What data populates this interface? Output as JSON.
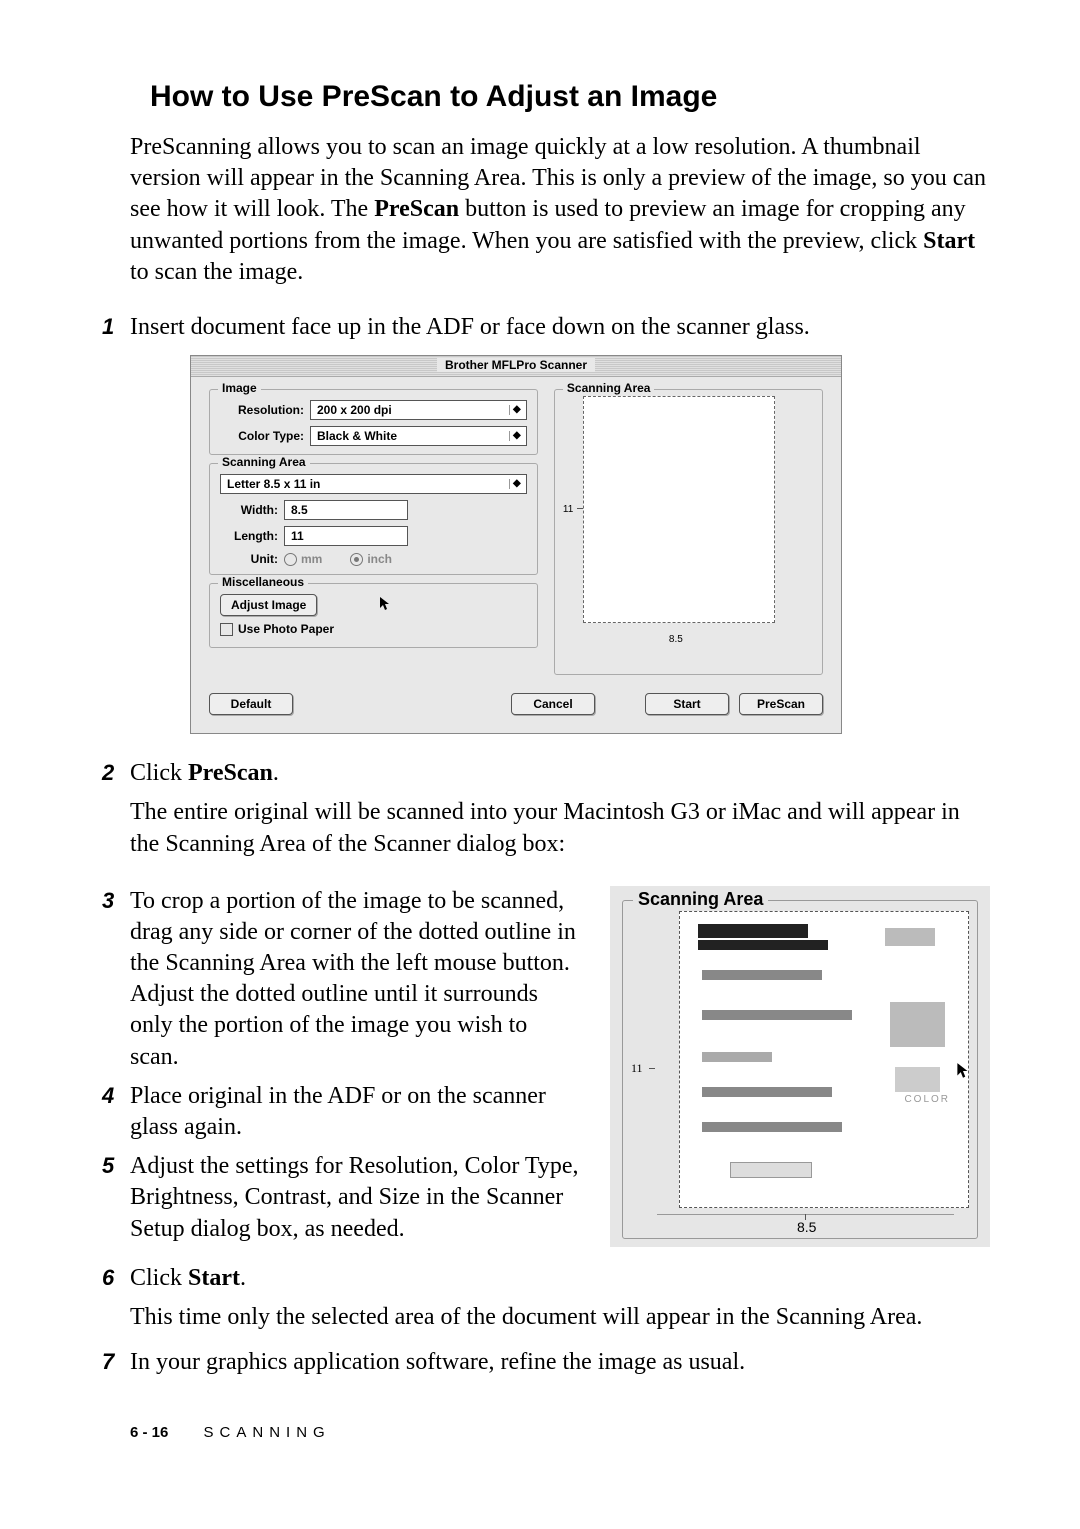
{
  "heading": "How to Use PreScan to Adjust an Image",
  "intro": {
    "t1": "PreScanning allows you to scan an image quickly at a low resolution. A thumbnail version will appear in the Scanning Area. This is only a preview of the image, so you can see how it will look. The ",
    "b1": "PreScan",
    "t2": " button is used to preview an image for cropping any unwanted portions from the image. When you are satisfied with the preview, click ",
    "b2": "Start",
    "t3": " to scan the image."
  },
  "steps": {
    "s1": {
      "num": "1",
      "text": "Insert document face up in the ADF or face down on the scanner glass."
    },
    "s2": {
      "num": "2",
      "t1": "Click ",
      "b1": "PreScan",
      "t2": ".",
      "after": "The entire original will be scanned into your Macintosh G3 or iMac and will appear in the Scanning Area of the Scanner dialog box:"
    },
    "s3": {
      "num": "3",
      "text": "To crop a portion of the image to be scanned, drag any side or corner of the dotted outline in the Scanning Area with the left mouse button. Adjust the dotted outline until it surrounds only the portion of the image you wish to scan."
    },
    "s4": {
      "num": "4",
      "text": "Place original in the ADF or on the scanner glass again."
    },
    "s5": {
      "num": "5",
      "text": "Adjust the settings for Resolution, Color Type, Brightness, Contrast, and Size in the Scanner Setup dialog box, as needed."
    },
    "s6": {
      "num": "6",
      "t1": "Click ",
      "b1": "Start",
      "t2": ".",
      "after": "This time only the selected area of the document will appear in the Scanning Area."
    },
    "s7": {
      "num": "7",
      "text": "In your graphics application software, refine the image as usual."
    }
  },
  "dialog": {
    "title": "Brother MFLPro Scanner",
    "groups": {
      "image": {
        "title": "Image",
        "resolution_label": "Resolution:",
        "resolution_value": "200 x 200 dpi",
        "colortype_label": "Color Type:",
        "colortype_value": "Black & White"
      },
      "scanarea": {
        "title": "Scanning Area",
        "preset_value": "Letter 8.5 x 11 in",
        "width_label": "Width:",
        "width_value": "8.5",
        "length_label": "Length:",
        "length_value": "11",
        "unit_label": "Unit:",
        "unit_mm": "mm",
        "unit_inch": "inch"
      },
      "misc": {
        "title": "Miscellaneous",
        "adjust_btn": "Adjust Image",
        "photo_paper": "Use Photo Paper"
      },
      "preview": {
        "title": "Scanning Area",
        "axis_y": "11",
        "axis_x": "8.5"
      }
    },
    "buttons": {
      "default": "Default",
      "cancel": "Cancel",
      "start": "Start",
      "prescan": "PreScan"
    }
  },
  "inset": {
    "title": "Scanning Area",
    "axis_y": "11",
    "axis_x": "8.5",
    "color_label": "COLOR"
  },
  "footer": {
    "page": "6 - 16",
    "section": "SCANNING"
  }
}
